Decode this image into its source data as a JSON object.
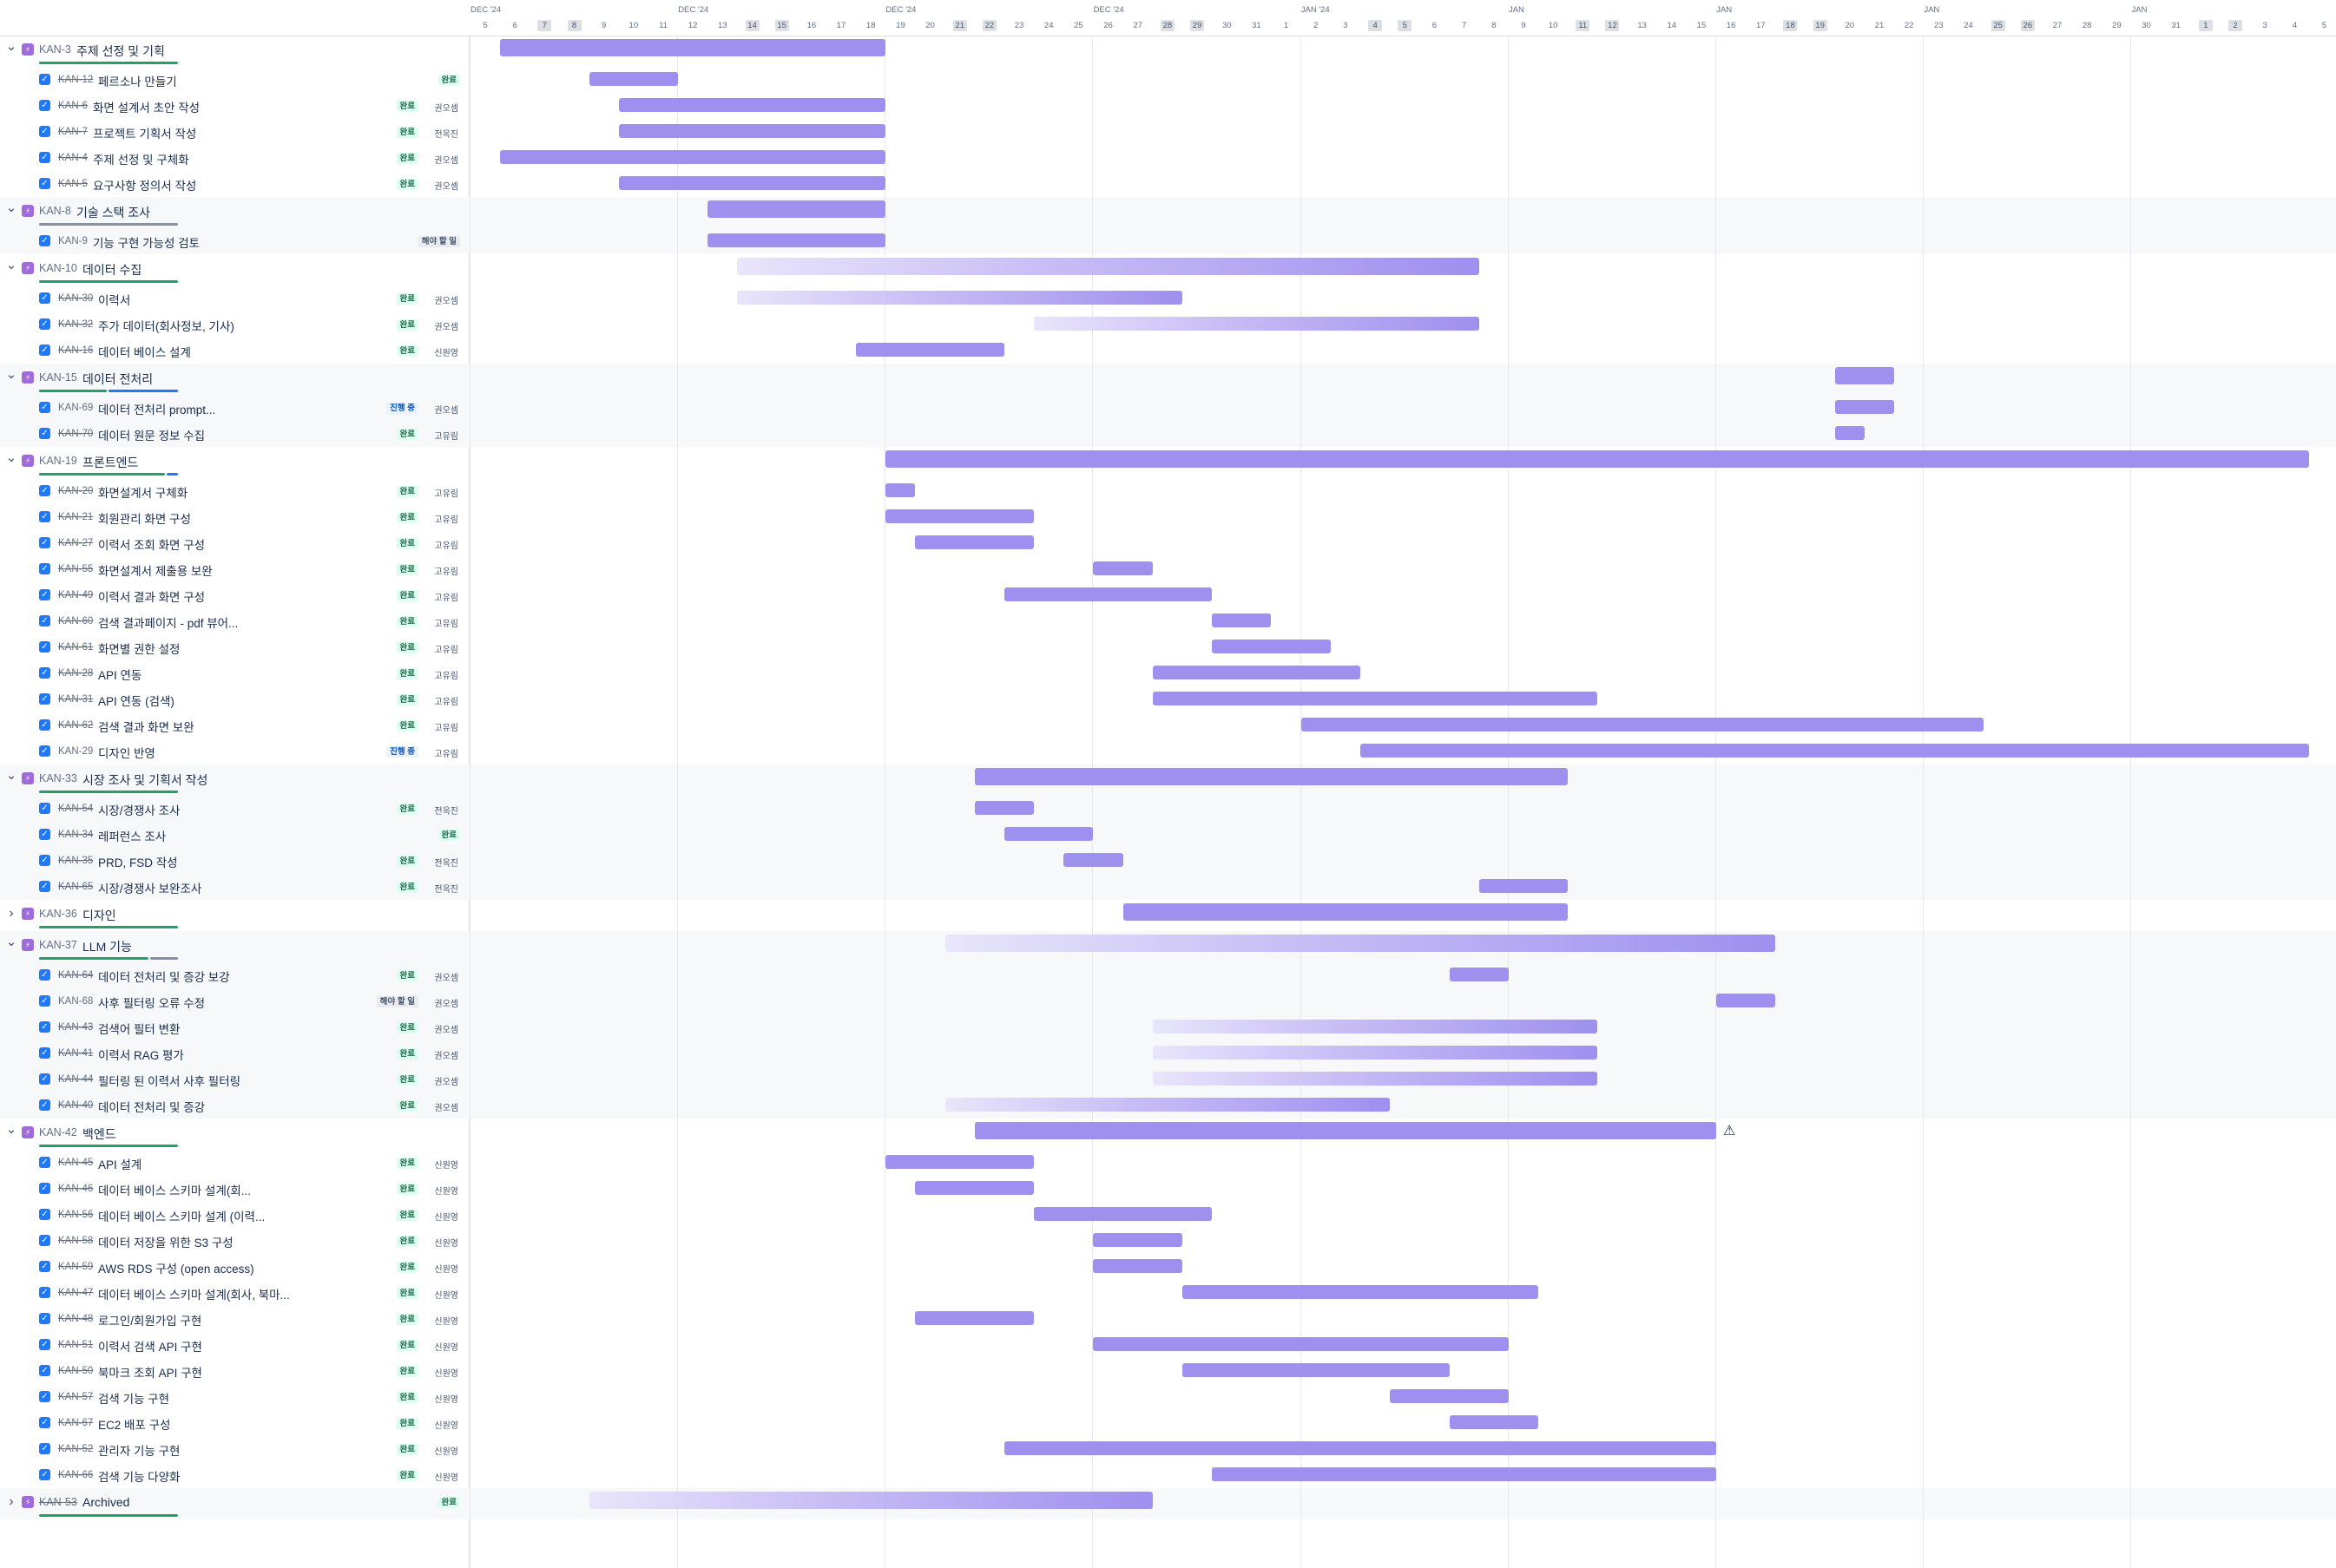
{
  "timeline": {
    "months": [
      {
        "label": "DEC '24",
        "day_index": 0
      },
      {
        "label": "DEC '24",
        "day_index": 7
      },
      {
        "label": "DEC '24",
        "day_index": 14
      },
      {
        "label": "DEC '24",
        "day_index": 21
      },
      {
        "label": "JAN '24",
        "day_index": 28
      },
      {
        "label": "JAN",
        "day_index": 35
      },
      {
        "label": "JAN",
        "day_index": 42
      },
      {
        "label": "JAN",
        "day_index": 49
      },
      {
        "label": "JAN",
        "day_index": 56
      }
    ],
    "days": [
      "5",
      "6",
      "7",
      "8",
      "9",
      "10",
      "11",
      "12",
      "13",
      "14",
      "15",
      "16",
      "17",
      "18",
      "19",
      "20",
      "21",
      "22",
      "23",
      "24",
      "25",
      "26",
      "27",
      "28",
      "29",
      "30",
      "31",
      "1",
      "2",
      "3",
      "4",
      "5",
      "6",
      "7",
      "8",
      "9",
      "10",
      "11",
      "12",
      "13",
      "14",
      "15",
      "16",
      "17",
      "18",
      "19",
      "20",
      "21",
      "22",
      "23",
      "24",
      "25",
      "26",
      "27",
      "28",
      "29",
      "30",
      "31",
      "1",
      "2",
      "3",
      "4",
      "5"
    ],
    "weekend_indices": [
      2,
      3,
      9,
      10,
      16,
      17,
      23,
      24,
      30,
      31,
      37,
      38,
      44,
      45,
      51,
      52,
      58,
      59
    ]
  },
  "rows": [
    {
      "type": "epic",
      "expanded": true,
      "key": "KAN-3",
      "title": "주제 선정 및 기획",
      "key_done": false,
      "progress": [
        {
          "color": "#22a06b",
          "frac": 1.0
        }
      ],
      "bar": {
        "start": 1,
        "end": 14,
        "fade": false
      }
    },
    {
      "type": "task",
      "key": "KAN-12",
      "title": "페르소나 만들기",
      "done": true,
      "status": "완료",
      "status_type": "done",
      "assignee": "",
      "bar": {
        "start": 4,
        "end": 7,
        "fade": false
      }
    },
    {
      "type": "task",
      "key": "KAN-6",
      "title": "화면 설계서 초안 작성",
      "done": true,
      "status": "완료",
      "status_type": "done",
      "assignee": "권오셈",
      "bar": {
        "start": 5,
        "end": 14,
        "fade": false
      }
    },
    {
      "type": "task",
      "key": "KAN-7",
      "title": "프로젝트 기획서 작성",
      "done": true,
      "status": "완료",
      "status_type": "done",
      "assignee": "전옥진",
      "bar": {
        "start": 5,
        "end": 14,
        "fade": false
      }
    },
    {
      "type": "task",
      "key": "KAN-4",
      "title": "주제 선정 및 구체화",
      "done": true,
      "status": "완료",
      "status_type": "done",
      "assignee": "권오셈",
      "bar": {
        "start": 1,
        "end": 14,
        "fade": false
      }
    },
    {
      "type": "task",
      "key": "KAN-5",
      "title": "요구사항 정의서 작성",
      "done": true,
      "status": "완료",
      "status_type": "done",
      "assignee": "권오셈",
      "bar": {
        "start": 5,
        "end": 14,
        "fade": false
      }
    },
    {
      "type": "epic",
      "expanded": true,
      "key": "KAN-8",
      "title": "기술 스택 조사",
      "key_done": false,
      "progress": [
        {
          "color": "#8590a2",
          "frac": 1.0
        }
      ],
      "bar": {
        "start": 8,
        "end": 14,
        "fade": false
      }
    },
    {
      "type": "task",
      "key": "KAN-9",
      "title": "기능 구현 가능성 검토",
      "done": false,
      "status": "해야 할 일",
      "status_type": "todo",
      "assignee": "",
      "bar": {
        "start": 8,
        "end": 14,
        "fade": false
      }
    },
    {
      "type": "epic",
      "expanded": true,
      "key": "KAN-10",
      "title": "데이터 수집",
      "key_done": false,
      "progress": [
        {
          "color": "#22a06b",
          "frac": 1.0
        }
      ],
      "bar": {
        "start": 9,
        "end": 34,
        "fade": true
      }
    },
    {
      "type": "task",
      "key": "KAN-30",
      "title": "이력서",
      "done": true,
      "status": "완료",
      "status_type": "done",
      "assignee": "권오셈",
      "bar": {
        "start": 9,
        "end": 24,
        "fade": true
      }
    },
    {
      "type": "task",
      "key": "KAN-32",
      "title": "주가 데이터(회사정보, 기사)",
      "done": true,
      "status": "완료",
      "status_type": "done",
      "assignee": "권오셈",
      "bar": {
        "start": 19,
        "end": 34,
        "fade": true
      }
    },
    {
      "type": "task",
      "key": "KAN-16",
      "title": "데이터 베이스 설계",
      "done": true,
      "status": "완료",
      "status_type": "done",
      "assignee": "신원영",
      "bar": {
        "start": 13,
        "end": 18,
        "fade": false
      }
    },
    {
      "type": "epic",
      "expanded": true,
      "key": "KAN-15",
      "title": "데이터 전처리",
      "key_done": false,
      "progress": [
        {
          "color": "#22a06b",
          "frac": 0.5
        },
        {
          "color": "#1d7afc",
          "frac": 0.5
        }
      ],
      "bar": {
        "start": 46,
        "end": 48,
        "fade": false
      }
    },
    {
      "type": "task",
      "key": "KAN-69",
      "title": "데이터 전처리 prompt...",
      "done": false,
      "status": "진행 중",
      "status_type": "prog",
      "assignee": "권오셈",
      "bar": {
        "start": 46,
        "end": 48,
        "fade": false
      }
    },
    {
      "type": "task",
      "key": "KAN-70",
      "title": "데이터 원문 정보 수집",
      "done": true,
      "status": "완료",
      "status_type": "done",
      "assignee": "고유림",
      "bar": {
        "start": 46,
        "end": 47,
        "fade": false
      }
    },
    {
      "type": "epic",
      "expanded": true,
      "key": "KAN-19",
      "title": "프론트엔드",
      "key_done": false,
      "progress": [
        {
          "color": "#22a06b",
          "frac": 0.92
        },
        {
          "color": "#1d7afc",
          "frac": 0.08
        }
      ],
      "bar": {
        "start": 14,
        "end": 62,
        "fade": false
      }
    },
    {
      "type": "task",
      "key": "KAN-20",
      "title": "화면설계서 구체화",
      "done": true,
      "status": "완료",
      "status_type": "done",
      "assignee": "고유림",
      "bar": {
        "start": 14,
        "end": 15,
        "fade": false
      }
    },
    {
      "type": "task",
      "key": "KAN-21",
      "title": "회원관리 화면 구성",
      "done": true,
      "status": "완료",
      "status_type": "done",
      "assignee": "고유림",
      "bar": {
        "start": 14,
        "end": 19,
        "fade": false
      }
    },
    {
      "type": "task",
      "key": "KAN-27",
      "title": "이력서 조회 화면 구성",
      "done": true,
      "status": "완료",
      "status_type": "done",
      "assignee": "고유림",
      "bar": {
        "start": 15,
        "end": 19,
        "fade": false
      }
    },
    {
      "type": "task",
      "key": "KAN-55",
      "title": "화면설계서 제출용 보완",
      "done": true,
      "status": "완료",
      "status_type": "done",
      "assignee": "고유림",
      "bar": {
        "start": 21,
        "end": 23,
        "fade": false
      }
    },
    {
      "type": "task",
      "key": "KAN-49",
      "title": "이력서 결과 화면 구성",
      "done": true,
      "status": "완료",
      "status_type": "done",
      "assignee": "고유림",
      "bar": {
        "start": 18,
        "end": 25,
        "fade": false
      }
    },
    {
      "type": "task",
      "key": "KAN-60",
      "title": "검색 결과페이지 - pdf 뷰어...",
      "done": true,
      "status": "완료",
      "status_type": "done",
      "assignee": "고유림",
      "bar": {
        "start": 25,
        "end": 27,
        "fade": false
      }
    },
    {
      "type": "task",
      "key": "KAN-61",
      "title": "화면별 권한 설정",
      "done": true,
      "status": "완료",
      "status_type": "done",
      "assignee": "고유림",
      "bar": {
        "start": 25,
        "end": 29,
        "fade": false
      }
    },
    {
      "type": "task",
      "key": "KAN-28",
      "title": "API 연동",
      "done": true,
      "status": "완료",
      "status_type": "done",
      "assignee": "고유림",
      "bar": {
        "start": 23,
        "end": 30,
        "fade": false
      }
    },
    {
      "type": "task",
      "key": "KAN-31",
      "title": "API 연동 (검색)",
      "done": true,
      "status": "완료",
      "status_type": "done",
      "assignee": "고유림",
      "bar": {
        "start": 23,
        "end": 38,
        "fade": false
      }
    },
    {
      "type": "task",
      "key": "KAN-62",
      "title": "검색 결과 화면 보완",
      "done": true,
      "status": "완료",
      "status_type": "done",
      "assignee": "고유림",
      "bar": {
        "start": 28,
        "end": 51,
        "fade": false
      }
    },
    {
      "type": "task",
      "key": "KAN-29",
      "title": "디자인 반영",
      "done": false,
      "status": "진행 중",
      "status_type": "prog",
      "assignee": "고유림",
      "bar": {
        "start": 30,
        "end": 62,
        "fade": false
      }
    },
    {
      "type": "epic",
      "expanded": true,
      "key": "KAN-33",
      "title": "시장 조사 및 기획서 작성",
      "key_done": false,
      "progress": [
        {
          "color": "#22a06b",
          "frac": 1.0
        }
      ],
      "bar": {
        "start": 17,
        "end": 37,
        "fade": false
      }
    },
    {
      "type": "task",
      "key": "KAN-54",
      "title": "시장/경쟁사 조사",
      "done": true,
      "status": "완료",
      "status_type": "done",
      "assignee": "전옥진",
      "bar": {
        "start": 17,
        "end": 19,
        "fade": false
      }
    },
    {
      "type": "task",
      "key": "KAN-34",
      "title": "레퍼런스 조사",
      "done": true,
      "status": "완료",
      "status_type": "done",
      "assignee": "",
      "bar": {
        "start": 18,
        "end": 21,
        "fade": false
      }
    },
    {
      "type": "task",
      "key": "KAN-35",
      "title": "PRD, FSD 작성",
      "done": true,
      "status": "완료",
      "status_type": "done",
      "assignee": "전옥진",
      "bar": {
        "start": 20,
        "end": 22,
        "fade": false
      }
    },
    {
      "type": "task",
      "key": "KAN-65",
      "title": "시장/경쟁사 보완조사",
      "done": true,
      "status": "완료",
      "status_type": "done",
      "assignee": "전옥진",
      "bar": {
        "start": 34,
        "end": 37,
        "fade": false
      }
    },
    {
      "type": "epic",
      "expanded": false,
      "key": "KAN-36",
      "title": "디자인",
      "key_done": false,
      "progress": [
        {
          "color": "#22a06b",
          "frac": 1.0
        }
      ],
      "bar": {
        "start": 22,
        "end": 37,
        "fade": false
      }
    },
    {
      "type": "epic",
      "expanded": true,
      "key": "KAN-37",
      "title": "LLM 기능",
      "key_done": false,
      "progress": [
        {
          "color": "#22a06b",
          "frac": 0.8
        },
        {
          "color": "#8590a2",
          "frac": 0.2
        }
      ],
      "bar": {
        "start": 16,
        "end": 44,
        "fade": true
      }
    },
    {
      "type": "task",
      "key": "KAN-64",
      "title": "데이터 전처리 및 증강 보강",
      "done": true,
      "status": "완료",
      "status_type": "done",
      "assignee": "권오셈",
      "bar": {
        "start": 33,
        "end": 35,
        "fade": false
      }
    },
    {
      "type": "task",
      "key": "KAN-68",
      "title": "사후 필터링 오류 수정",
      "done": false,
      "status": "해야 할 일",
      "status_type": "todo",
      "assignee": "권오셈",
      "bar": {
        "start": 42,
        "end": 44,
        "fade": false
      }
    },
    {
      "type": "task",
      "key": "KAN-43",
      "title": "검색어 필터 변환",
      "done": true,
      "status": "완료",
      "status_type": "done",
      "assignee": "권오셈",
      "bar": {
        "start": 23,
        "end": 38,
        "fade": true
      }
    },
    {
      "type": "task",
      "key": "KAN-41",
      "title": "이력서 RAG 평가",
      "done": true,
      "status": "완료",
      "status_type": "done",
      "assignee": "권오셈",
      "bar": {
        "start": 23,
        "end": 38,
        "fade": true
      }
    },
    {
      "type": "task",
      "key": "KAN-44",
      "title": "필터링 된 이력서 사후 필터링",
      "done": true,
      "status": "완료",
      "status_type": "done",
      "assignee": "권오셈",
      "bar": {
        "start": 23,
        "end": 38,
        "fade": true
      }
    },
    {
      "type": "task",
      "key": "KAN-40",
      "title": "데이터 전처리 및 증강",
      "done": true,
      "status": "완료",
      "status_type": "done",
      "assignee": "권오셈",
      "bar": {
        "start": 16,
        "end": 31,
        "fade": true
      }
    },
    {
      "type": "epic",
      "expanded": true,
      "key": "KAN-42",
      "title": "백엔드",
      "key_done": false,
      "progress": [
        {
          "color": "#22a06b",
          "frac": 1.0
        }
      ],
      "bar": {
        "start": 17,
        "end": 42,
        "fade": false
      },
      "warning": true
    },
    {
      "type": "task",
      "key": "KAN-45",
      "title": "API 설계",
      "done": true,
      "status": "완료",
      "status_type": "done",
      "assignee": "신원영",
      "bar": {
        "start": 14,
        "end": 19,
        "fade": false
      }
    },
    {
      "type": "task",
      "key": "KAN-46",
      "title": "데이터 베이스 스키마 설계(회...",
      "done": true,
      "status": "완료",
      "status_type": "done",
      "assignee": "신원영",
      "bar": {
        "start": 15,
        "end": 19,
        "fade": false
      }
    },
    {
      "type": "task",
      "key": "KAN-56",
      "title": "데이터 베이스 스키마 설계 (이력...",
      "done": true,
      "status": "완료",
      "status_type": "done",
      "assignee": "신원영",
      "bar": {
        "start": 19,
        "end": 25,
        "fade": false
      }
    },
    {
      "type": "task",
      "key": "KAN-58",
      "title": "데이터 저장을 위한 S3 구성",
      "done": true,
      "status": "완료",
      "status_type": "done",
      "assignee": "신원영",
      "bar": {
        "start": 21,
        "end": 24,
        "fade": false
      }
    },
    {
      "type": "task",
      "key": "KAN-59",
      "title": "AWS RDS 구성 (open access)",
      "done": true,
      "status": "완료",
      "status_type": "done",
      "assignee": "신원영",
      "bar": {
        "start": 21,
        "end": 24,
        "fade": false
      }
    },
    {
      "type": "task",
      "key": "KAN-47",
      "title": "데이터 베이스 스키마 설계(회사, 북마...",
      "done": true,
      "status": "완료",
      "status_type": "done",
      "assignee": "신원영",
      "bar": {
        "start": 24,
        "end": 36,
        "fade": false
      }
    },
    {
      "type": "task",
      "key": "KAN-48",
      "title": "로그인/회원가입 구현",
      "done": true,
      "status": "완료",
      "status_type": "done",
      "assignee": "신원영",
      "bar": {
        "start": 15,
        "end": 19,
        "fade": false
      }
    },
    {
      "type": "task",
      "key": "KAN-51",
      "title": "이력서 검색 API 구현",
      "done": true,
      "status": "완료",
      "status_type": "done",
      "assignee": "신원영",
      "bar": {
        "start": 21,
        "end": 35,
        "fade": false
      }
    },
    {
      "type": "task",
      "key": "KAN-50",
      "title": "북마크 조회 API 구현",
      "done": true,
      "status": "완료",
      "status_type": "done",
      "assignee": "신원영",
      "bar": {
        "start": 24,
        "end": 33,
        "fade": false
      }
    },
    {
      "type": "task",
      "key": "KAN-57",
      "title": "검색 기능 구현",
      "done": true,
      "status": "완료",
      "status_type": "done",
      "assignee": "신원영",
      "bar": {
        "start": 31,
        "end": 35,
        "fade": false
      }
    },
    {
      "type": "task",
      "key": "KAN-67",
      "title": "EC2 배포 구성",
      "done": true,
      "status": "완료",
      "status_type": "done",
      "assignee": "신원영",
      "bar": {
        "start": 33,
        "end": 36,
        "fade": false
      }
    },
    {
      "type": "task",
      "key": "KAN-52",
      "title": "관리자 기능 구현",
      "done": true,
      "status": "완료",
      "status_type": "done",
      "assignee": "신원영",
      "bar": {
        "start": 18,
        "end": 42,
        "fade": false
      }
    },
    {
      "type": "task",
      "key": "KAN-66",
      "title": "검색 기능 다양화",
      "done": true,
      "status": "완료",
      "status_type": "done",
      "assignee": "신원영",
      "bar": {
        "start": 25,
        "end": 42,
        "fade": false
      }
    },
    {
      "type": "epic",
      "expanded": false,
      "key": "KAN-53",
      "title": "Archived",
      "key_done": true,
      "status": "완료",
      "status_type": "done",
      "progress": [
        {
          "color": "#22a06b",
          "frac": 1.0
        }
      ],
      "bar": {
        "start": 4,
        "end": 23,
        "fade": true
      }
    }
  ],
  "icons": {
    "check": "check-icon",
    "epic": "epic-lightning-icon",
    "chev_down": "chevron-down-icon",
    "chev_right": "chevron-right-icon",
    "warning": "warning-icon"
  }
}
